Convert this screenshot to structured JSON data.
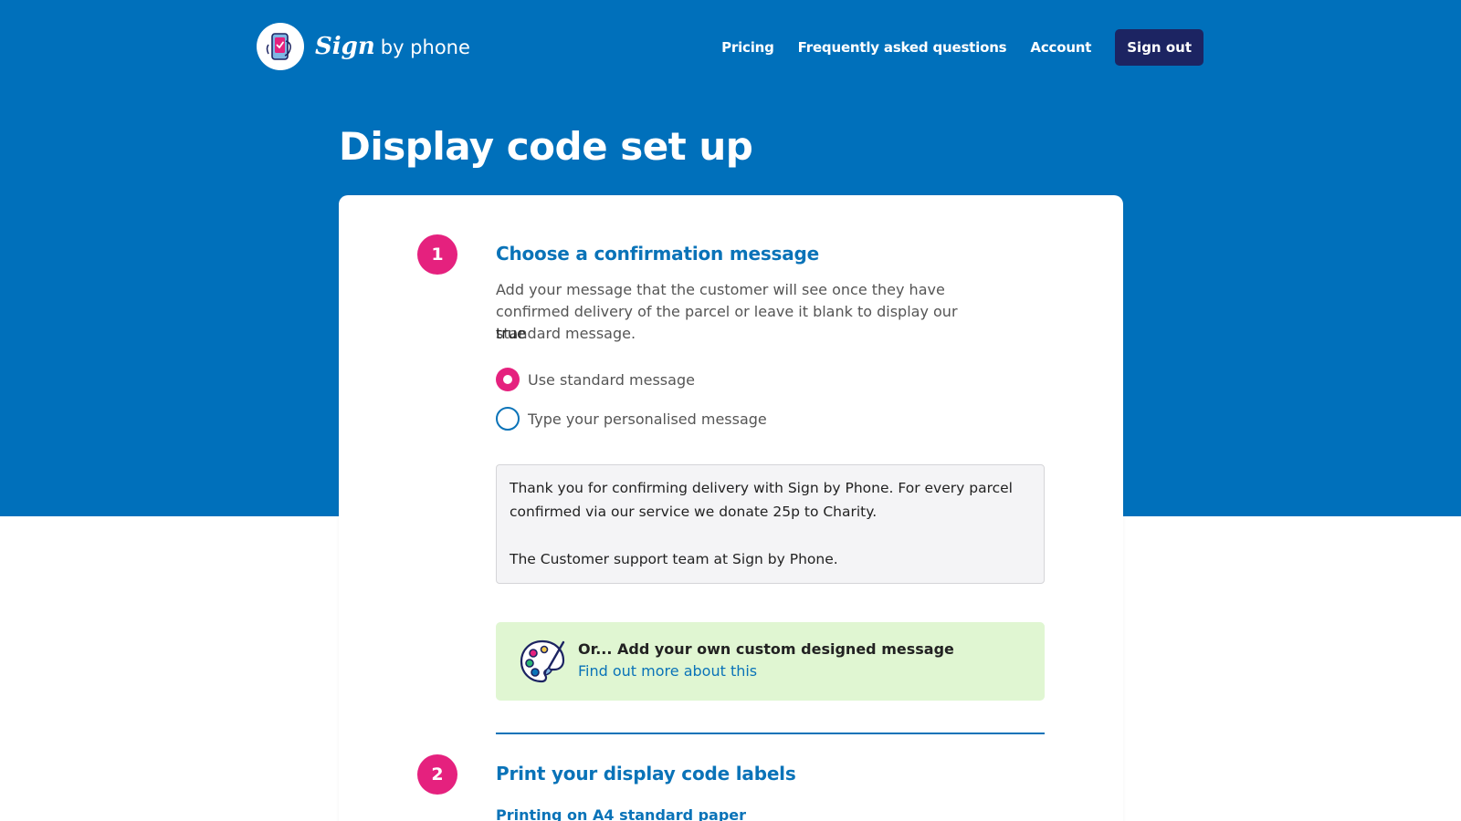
{
  "header": {
    "logo_sign": "Sign",
    "logo_rest": "by phone",
    "nav": [
      "Pricing",
      "Frequently asked questions",
      "Account"
    ],
    "signout_label": "Sign out"
  },
  "page": {
    "title": "Display code set up"
  },
  "step1": {
    "number": "1",
    "heading": "Choose a confirmation message",
    "description": "Add your message that the customer will see once they have confirmed delivery of the parcel or leave it blank to display our standard message.",
    "value": "true",
    "options": [
      {
        "label": "Use standard message",
        "selected": true
      },
      {
        "label": "Type your personalised message",
        "selected": false
      }
    ],
    "message_lines": [
      "Thank you for confirming delivery with Sign by Phone. For every parcel confirmed via our service we donate 25p to Charity.",
      "The Customer support team at Sign by Phone."
    ],
    "custom_title": "Or... Add your own custom designed message",
    "custom_link": "Find out more about this"
  },
  "step2": {
    "number": "2",
    "heading": "Print your display code labels",
    "subheading": "Printing on A4 standard paper"
  },
  "colors": {
    "brand_blue": "#0070bb",
    "accent_pink": "#e5217e",
    "navy": "#1c2462",
    "link_blue": "#0a73b8",
    "custom_bg": "#e0f6d2"
  },
  "icons": [
    "phone-check-logo-icon",
    "palette-icon"
  ]
}
